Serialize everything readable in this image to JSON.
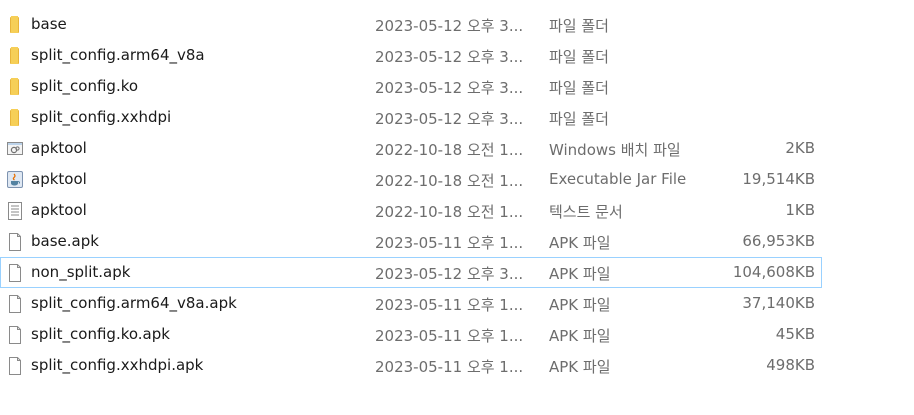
{
  "files": [
    {
      "name": "base",
      "modified": "2023-05-12 오후 3...",
      "type": "파일 폴더",
      "size": "",
      "icon": "folder-icon"
    },
    {
      "name": "split_config.arm64_v8a",
      "modified": "2023-05-12 오후 3...",
      "type": "파일 폴더",
      "size": "",
      "icon": "folder-icon"
    },
    {
      "name": "split_config.ko",
      "modified": "2023-05-12 오후 3...",
      "type": "파일 폴더",
      "size": "",
      "icon": "folder-icon"
    },
    {
      "name": "split_config.xxhdpi",
      "modified": "2023-05-12 오후 3...",
      "type": "파일 폴더",
      "size": "",
      "icon": "folder-icon"
    },
    {
      "name": "apktool",
      "modified": "2022-10-18 오전 1...",
      "type": "Windows 배치 파일",
      "size": "2KB",
      "icon": "batch-file-icon"
    },
    {
      "name": "apktool",
      "modified": "2022-10-18 오전 1...",
      "type": "Executable Jar File",
      "size": "19,514KB",
      "icon": "java-jar-icon"
    },
    {
      "name": "apktool",
      "modified": "2022-10-18 오전 1...",
      "type": "텍스트 문서",
      "size": "1KB",
      "icon": "text-file-icon"
    },
    {
      "name": "base.apk",
      "modified": "2023-05-11 오후 1...",
      "type": "APK 파일",
      "size": "66,953KB",
      "icon": "file-icon"
    },
    {
      "name": "non_split.apk",
      "modified": "2023-05-12 오후 3...",
      "type": "APK 파일",
      "size": "104,608KB",
      "icon": "file-icon"
    },
    {
      "name": "split_config.arm64_v8a.apk",
      "modified": "2023-05-11 오후 1...",
      "type": "APK 파일",
      "size": "37,140KB",
      "icon": "file-icon"
    },
    {
      "name": "split_config.ko.apk",
      "modified": "2023-05-11 오후 1...",
      "type": "APK 파일",
      "size": "45KB",
      "icon": "file-icon"
    },
    {
      "name": "split_config.xxhdpi.apk",
      "modified": "2023-05-11 오후 1...",
      "type": "APK 파일",
      "size": "498KB",
      "icon": "file-icon"
    }
  ],
  "hovered_row": "non_split.apk",
  "colors": {
    "folder": "#f0c040",
    "hover_border": "#99d1ff",
    "secondary_text": "#6d6d6d"
  }
}
